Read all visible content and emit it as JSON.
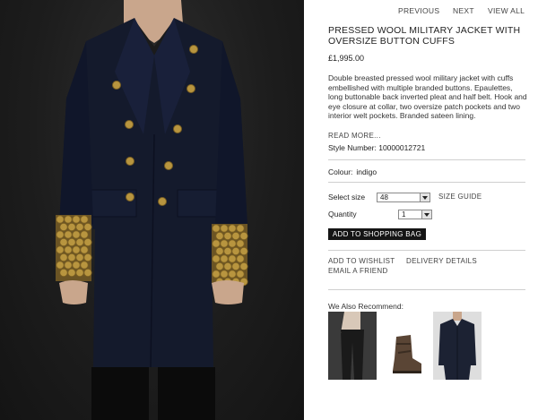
{
  "nav": {
    "previous": "PREVIOUS",
    "next": "NEXT",
    "view_all": "VIEW ALL"
  },
  "product": {
    "title": "PRESSED WOOL MILITARY JACKET WITH OVERSIZE BUTTON CUFFS",
    "price": "£1,995.00",
    "description": "Double breasted pressed wool military jacket with cuffs embellished with multiple branded buttons. Epaulettes, long buttonable back inverted pleat and half belt. Hook and eye closure at collar, two oversize patch pockets and two interior welt pockets. Branded sateen lining.",
    "read_more": "READ MORE...",
    "style_number": "Style Number: 10000012721",
    "colour_label": "Colour:",
    "colour_value": "indigo"
  },
  "purchase": {
    "size_label": "Select size",
    "size_value": "48",
    "size_guide": "SIZE GUIDE",
    "quantity_label": "Quantity",
    "quantity_value": "1",
    "add_to_bag": "ADD TO SHOPPING BAG"
  },
  "actions": {
    "wishlist": "ADD TO WISHLIST",
    "delivery": "DELIVERY DETAILS",
    "email": "EMAIL A FRIEND"
  },
  "recommend": {
    "heading": "We Also Recommend:",
    "items": [
      "trousers",
      "boots",
      "shirt"
    ]
  },
  "colors": {
    "coat": "#141a2c",
    "background": "#1e1e1e",
    "gold": "#b8953f",
    "button_bg": "#151515"
  }
}
